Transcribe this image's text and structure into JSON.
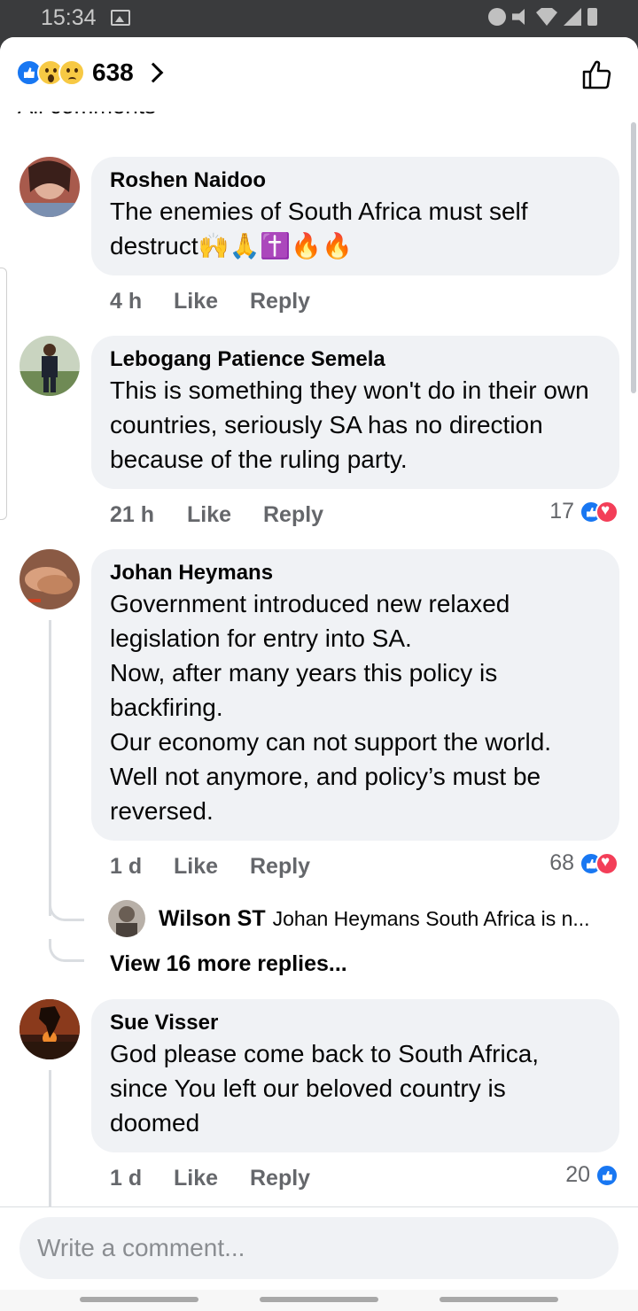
{
  "status_bar": {
    "time": "15:34"
  },
  "header": {
    "reaction_count": "638",
    "sort_label": "All comments"
  },
  "comments": [
    {
      "author": "Roshen Naidoo",
      "text": "The enemies of South Africa must self destruct🙌🙏✝️🔥🔥",
      "time": "4 h",
      "like": "Like",
      "reply": "Reply"
    },
    {
      "author": "Lebogang Patience Semela",
      "text": "This is something they won't do in their own countries, seriously SA has no direction because of the ruling party.",
      "time": "21 h",
      "like": "Like",
      "reply": "Reply",
      "reactions": "17"
    },
    {
      "author": "Johan Heymans",
      "text": "Government introduced new relaxed legislation for entry into SA.\nNow, after many years this policy is backfiring.\nOur economy can not support the world. Well not anymore, and policy’s must be reversed.",
      "time": "1 d",
      "like": "Like",
      "reply": "Reply",
      "reactions": "68",
      "reply_preview": {
        "author": "Wilson ST",
        "text": "Johan Heymans South Africa is n..."
      },
      "view_more": "View 16 more replies..."
    },
    {
      "author": "Sue Visser",
      "text": "God please come back to South Africa, since You left our beloved country is doomed",
      "time": "1 d",
      "like": "Like",
      "reply": "Reply",
      "reactions": "20"
    }
  ],
  "composer": {
    "placeholder": "Write a comment..."
  },
  "colors": {
    "accent": "#1877f2",
    "love": "#f33e58",
    "bubble": "#f0f2f5",
    "meta": "#65676b"
  }
}
